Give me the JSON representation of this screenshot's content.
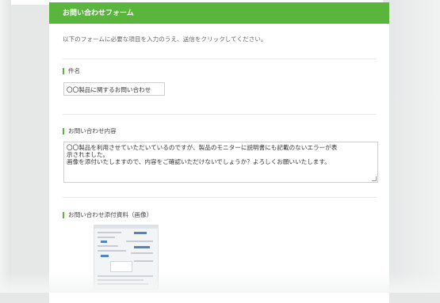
{
  "form": {
    "title": "お問い合わせフォーム",
    "intro": "以下のフォームに必要な項目を入力のうえ、送信をクリックしてください。"
  },
  "fields": {
    "subject": {
      "label": "件名",
      "value": "〇〇製品に関するお問い合わせ"
    },
    "content": {
      "label": "お問い合わせ内容",
      "lines": [
        "〇〇製品を利用させていただいているのですが、製品のモニターに説明書にも記載のないエラーが表",
        "示されました。",
        "画像を添付いたしますので、内容をご確認いただけないでしょうか？よろしくお願いいたします。"
      ]
    },
    "attachment": {
      "label": "お問い合わせ添付資料（画像）"
    }
  },
  "colors": {
    "accent": "#5ab53c",
    "text": "#333333",
    "muted": "#666666"
  }
}
